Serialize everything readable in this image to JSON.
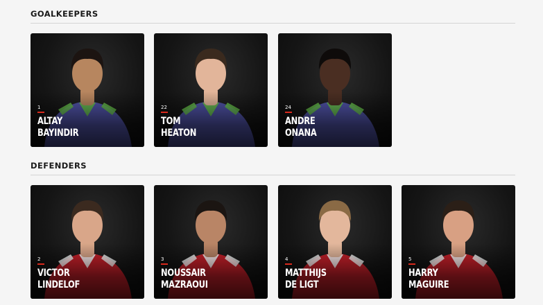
{
  "sections": [
    {
      "title": "GOALKEEPERS",
      "players": [
        {
          "number": "1",
          "first": "ALTAY",
          "last": "BAYINDIR",
          "skin": "#b7865f",
          "hair": "#1c1411",
          "kit": "#4f52a6",
          "trim": "#66c04a"
        },
        {
          "number": "22",
          "first": "TOM",
          "last": "HEATON",
          "skin": "#e2b59a",
          "hair": "#3a2a1e",
          "kit": "#4f52a6",
          "trim": "#66c04a"
        },
        {
          "number": "24",
          "first": "ANDRE",
          "last": "ONANA",
          "skin": "#4a2e22",
          "hair": "#0e0b0a",
          "kit": "#4f52a6",
          "trim": "#66c04a"
        }
      ]
    },
    {
      "title": "DEFENDERS",
      "players": [
        {
          "number": "2",
          "first": "VICTOR",
          "last": "LINDELOF",
          "skin": "#d9a689",
          "hair": "#3b2a1f",
          "kit": "#c8202a",
          "trim": "#ffffff"
        },
        {
          "number": "3",
          "first": "NOUSSAIR",
          "last": "MAZRAOUI",
          "skin": "#b98566",
          "hair": "#1b1512",
          "kit": "#c8202a",
          "trim": "#ffffff"
        },
        {
          "number": "4",
          "first": "MATTHIJS",
          "last": "DE LIGT",
          "skin": "#e3b79c",
          "hair": "#8a6a45",
          "kit": "#c8202a",
          "trim": "#ffffff"
        },
        {
          "number": "5",
          "first": "HARRY",
          "last": "MAGUIRE",
          "skin": "#d8a083",
          "hair": "#2b1f17",
          "kit": "#c8202a",
          "trim": "#ffffff"
        }
      ]
    }
  ]
}
